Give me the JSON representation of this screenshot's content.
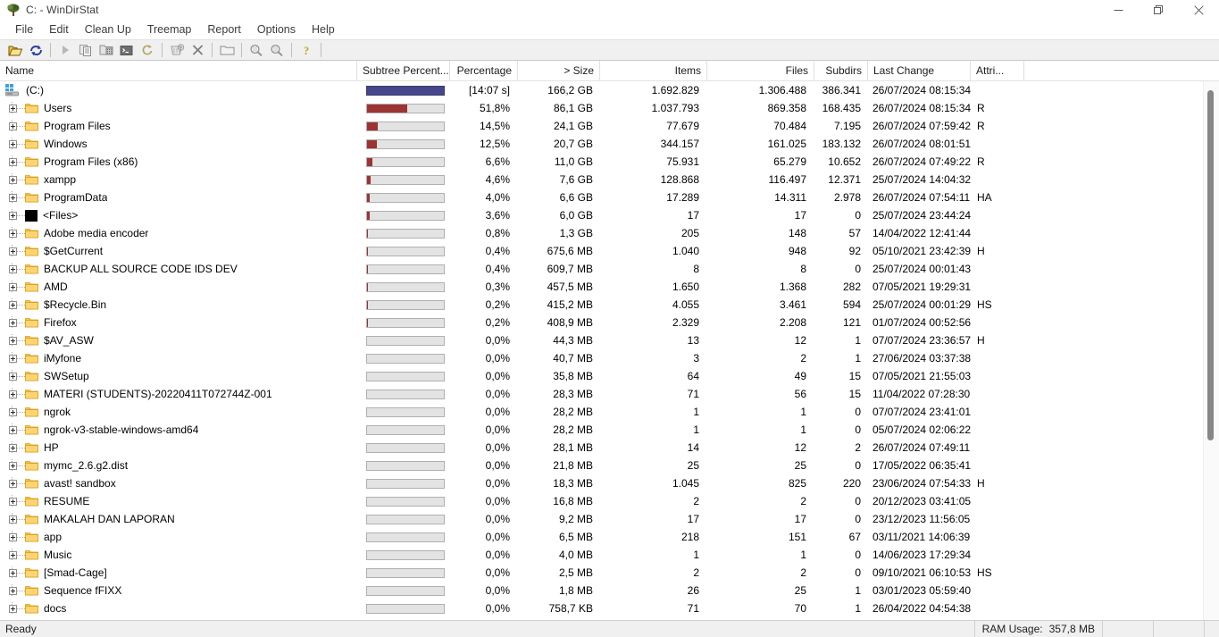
{
  "window": {
    "title": "C: - WinDirStat",
    "app_icon": "tree-icon",
    "minimize_label": "Minimize",
    "maximize_label": "Restore",
    "close_label": "Close"
  },
  "menubar": {
    "items": [
      {
        "label": "File"
      },
      {
        "label": "Edit"
      },
      {
        "label": "Clean Up"
      },
      {
        "label": "Treemap"
      },
      {
        "label": "Report"
      },
      {
        "label": "Options"
      },
      {
        "label": "Help"
      }
    ]
  },
  "toolbar": {
    "buttons": [
      {
        "name": "open-folder-icon",
        "enabled": true
      },
      {
        "name": "rescan-icon",
        "enabled": true
      },
      {
        "name": "separator",
        "enabled": false
      },
      {
        "name": "play-resume-icon",
        "enabled": false
      },
      {
        "name": "copy-path-icon",
        "enabled": false
      },
      {
        "name": "explorer-here-icon",
        "enabled": false
      },
      {
        "name": "command-prompt-icon",
        "enabled": false
      },
      {
        "name": "refresh-selected-icon",
        "enabled": false
      },
      {
        "name": "separator",
        "enabled": false
      },
      {
        "name": "delete-to-recycle-bin-icon",
        "enabled": false
      },
      {
        "name": "delete-icon",
        "enabled": false
      },
      {
        "name": "separator",
        "enabled": false
      },
      {
        "name": "show-treemap-icon",
        "enabled": false
      },
      {
        "name": "separator",
        "enabled": false
      },
      {
        "name": "zoom-in-icon",
        "enabled": false
      },
      {
        "name": "zoom-out-icon",
        "enabled": false
      },
      {
        "name": "separator",
        "enabled": false
      },
      {
        "name": "help-icon",
        "enabled": true
      }
    ]
  },
  "columns": [
    {
      "key": "name",
      "label": "Name",
      "align": "left"
    },
    {
      "key": "bar",
      "label": "Subtree Percent...",
      "align": "left"
    },
    {
      "key": "pct",
      "label": "Percentage",
      "align": "right"
    },
    {
      "key": "size",
      "label": "> Size",
      "align": "right"
    },
    {
      "key": "items",
      "label": "Items",
      "align": "right"
    },
    {
      "key": "files",
      "label": "Files",
      "align": "right"
    },
    {
      "key": "subdirs",
      "label": "Subdirs",
      "align": "right"
    },
    {
      "key": "change",
      "label": "Last Change",
      "align": "left"
    },
    {
      "key": "attr",
      "label": "Attri...",
      "align": "left"
    }
  ],
  "colors": {
    "root_bar": "#45468c",
    "child_bar": "#9c3434",
    "bar_track": "#e3e3e3",
    "folder": "#fbc34a",
    "selection": "#cce8ff"
  },
  "rows": [
    {
      "name": "(C:)",
      "icon": "drive-icon",
      "depth": 0,
      "expandable": false,
      "barpct": 100,
      "barstyle": "root",
      "pct": "[14:07 s]",
      "size": "166,2 GB",
      "items": "1.692.829",
      "files": "1.306.488",
      "subdirs": "386.341",
      "change": "26/07/2024  08:15:34",
      "attr": ""
    },
    {
      "name": "Users",
      "icon": "folder-icon",
      "depth": 1,
      "expandable": true,
      "barpct": 51.8,
      "barstyle": "child",
      "pct": "51,8%",
      "size": "86,1 GB",
      "items": "1.037.793",
      "files": "869.358",
      "subdirs": "168.435",
      "change": "26/07/2024  08:15:34",
      "attr": "R"
    },
    {
      "name": "Program Files",
      "icon": "folder-icon",
      "depth": 1,
      "expandable": true,
      "barpct": 14.5,
      "barstyle": "child",
      "pct": "14,5%",
      "size": "24,1 GB",
      "items": "77.679",
      "files": "70.484",
      "subdirs": "7.195",
      "change": "26/07/2024  07:59:42",
      "attr": "R"
    },
    {
      "name": "Windows",
      "icon": "folder-icon",
      "depth": 1,
      "expandable": true,
      "barpct": 12.5,
      "barstyle": "child",
      "pct": "12,5%",
      "size": "20,7 GB",
      "items": "344.157",
      "files": "161.025",
      "subdirs": "183.132",
      "change": "26/07/2024  08:01:51",
      "attr": ""
    },
    {
      "name": "Program Files (x86)",
      "icon": "folder-icon",
      "depth": 1,
      "expandable": true,
      "barpct": 6.6,
      "barstyle": "child",
      "pct": "6,6%",
      "size": "11,0 GB",
      "items": "75.931",
      "files": "65.279",
      "subdirs": "10.652",
      "change": "26/07/2024  07:49:22",
      "attr": "R"
    },
    {
      "name": "xampp",
      "icon": "folder-icon",
      "depth": 1,
      "expandable": true,
      "barpct": 4.6,
      "barstyle": "child",
      "pct": "4,6%",
      "size": "7,6 GB",
      "items": "128.868",
      "files": "116.497",
      "subdirs": "12.371",
      "change": "25/07/2024  14:04:32",
      "attr": ""
    },
    {
      "name": "ProgramData",
      "icon": "folder-icon",
      "depth": 1,
      "expandable": true,
      "barpct": 4.0,
      "barstyle": "child",
      "pct": "4,0%",
      "size": "6,6 GB",
      "items": "17.289",
      "files": "14.311",
      "subdirs": "2.978",
      "change": "26/07/2024  07:54:11",
      "attr": "HA"
    },
    {
      "name": "<Files>",
      "icon": "files-node-icon",
      "depth": 1,
      "expandable": true,
      "barpct": 3.6,
      "barstyle": "child",
      "pct": "3,6%",
      "size": "6,0 GB",
      "items": "17",
      "files": "17",
      "subdirs": "0",
      "change": "25/07/2024  23:44:24",
      "attr": ""
    },
    {
      "name": "Adobe media encoder",
      "icon": "folder-icon",
      "depth": 1,
      "expandable": true,
      "barpct": 0.8,
      "barstyle": "child",
      "pct": "0,8%",
      "size": "1,3 GB",
      "items": "205",
      "files": "148",
      "subdirs": "57",
      "change": "14/04/2022  12:41:44",
      "attr": ""
    },
    {
      "name": "$GetCurrent",
      "icon": "folder-icon",
      "depth": 1,
      "expandable": true,
      "barpct": 0.4,
      "barstyle": "child",
      "pct": "0,4%",
      "size": "675,6 MB",
      "items": "1.040",
      "files": "948",
      "subdirs": "92",
      "change": "05/10/2021  23:42:39",
      "attr": "H"
    },
    {
      "name": "BACKUP ALL SOURCE CODE IDS DEV",
      "icon": "folder-icon",
      "depth": 1,
      "expandable": true,
      "barpct": 0.4,
      "barstyle": "child",
      "pct": "0,4%",
      "size": "609,7 MB",
      "items": "8",
      "files": "8",
      "subdirs": "0",
      "change": "25/07/2024  00:01:43",
      "attr": ""
    },
    {
      "name": "AMD",
      "icon": "folder-icon",
      "depth": 1,
      "expandable": true,
      "barpct": 0.3,
      "barstyle": "child",
      "pct": "0,3%",
      "size": "457,5 MB",
      "items": "1.650",
      "files": "1.368",
      "subdirs": "282",
      "change": "07/05/2021  19:29:31",
      "attr": ""
    },
    {
      "name": "$Recycle.Bin",
      "icon": "folder-icon",
      "depth": 1,
      "expandable": true,
      "barpct": 0.2,
      "barstyle": "child",
      "pct": "0,2%",
      "size": "415,2 MB",
      "items": "4.055",
      "files": "3.461",
      "subdirs": "594",
      "change": "25/07/2024  00:01:29",
      "attr": "HS"
    },
    {
      "name": "Firefox",
      "icon": "folder-icon",
      "depth": 1,
      "expandable": true,
      "barpct": 0.2,
      "barstyle": "child",
      "pct": "0,2%",
      "size": "408,9 MB",
      "items": "2.329",
      "files": "2.208",
      "subdirs": "121",
      "change": "01/07/2024  00:52:56",
      "attr": ""
    },
    {
      "name": "$AV_ASW",
      "icon": "folder-icon",
      "depth": 1,
      "expandable": true,
      "barpct": 0,
      "barstyle": "child",
      "pct": "0,0%",
      "size": "44,3 MB",
      "items": "13",
      "files": "12",
      "subdirs": "1",
      "change": "07/07/2024  23:36:57",
      "attr": "H"
    },
    {
      "name": "iMyfone",
      "icon": "folder-icon",
      "depth": 1,
      "expandable": true,
      "barpct": 0,
      "barstyle": "child",
      "pct": "0,0%",
      "size": "40,7 MB",
      "items": "3",
      "files": "2",
      "subdirs": "1",
      "change": "27/06/2024  03:37:38",
      "attr": ""
    },
    {
      "name": "SWSetup",
      "icon": "folder-icon",
      "depth": 1,
      "expandable": true,
      "barpct": 0,
      "barstyle": "child",
      "pct": "0,0%",
      "size": "35,8 MB",
      "items": "64",
      "files": "49",
      "subdirs": "15",
      "change": "07/05/2021  21:55:03",
      "attr": ""
    },
    {
      "name": "MATERI (STUDENTS)-20220411T072744Z-001",
      "icon": "folder-icon",
      "depth": 1,
      "expandable": true,
      "barpct": 0,
      "barstyle": "child",
      "pct": "0,0%",
      "size": "28,3 MB",
      "items": "71",
      "files": "56",
      "subdirs": "15",
      "change": "11/04/2022  07:28:30",
      "attr": ""
    },
    {
      "name": "ngrok",
      "icon": "folder-icon",
      "depth": 1,
      "expandable": true,
      "barpct": 0,
      "barstyle": "child",
      "pct": "0,0%",
      "size": "28,2 MB",
      "items": "1",
      "files": "1",
      "subdirs": "0",
      "change": "07/07/2024  23:41:01",
      "attr": ""
    },
    {
      "name": "ngrok-v3-stable-windows-amd64",
      "icon": "folder-icon",
      "depth": 1,
      "expandable": true,
      "barpct": 0,
      "barstyle": "child",
      "pct": "0,0%",
      "size": "28,2 MB",
      "items": "1",
      "files": "1",
      "subdirs": "0",
      "change": "05/07/2024  02:06:22",
      "attr": ""
    },
    {
      "name": "HP",
      "icon": "folder-icon",
      "depth": 1,
      "expandable": true,
      "barpct": 0,
      "barstyle": "child",
      "pct": "0,0%",
      "size": "28,1 MB",
      "items": "14",
      "files": "12",
      "subdirs": "2",
      "change": "26/07/2024  07:49:11",
      "attr": ""
    },
    {
      "name": "mymc_2.6.g2.dist",
      "icon": "folder-icon",
      "depth": 1,
      "expandable": true,
      "barpct": 0,
      "barstyle": "child",
      "pct": "0,0%",
      "size": "21,8 MB",
      "items": "25",
      "files": "25",
      "subdirs": "0",
      "change": "17/05/2022  06:35:41",
      "attr": ""
    },
    {
      "name": "avast! sandbox",
      "icon": "folder-icon",
      "depth": 1,
      "expandable": true,
      "barpct": 0,
      "barstyle": "child",
      "pct": "0,0%",
      "size": "18,3 MB",
      "items": "1.045",
      "files": "825",
      "subdirs": "220",
      "change": "23/06/2024  07:54:33",
      "attr": "H"
    },
    {
      "name": "RESUME",
      "icon": "folder-icon",
      "depth": 1,
      "expandable": true,
      "barpct": 0,
      "barstyle": "child",
      "pct": "0,0%",
      "size": "16,8 MB",
      "items": "2",
      "files": "2",
      "subdirs": "0",
      "change": "20/12/2023  03:41:05",
      "attr": ""
    },
    {
      "name": "MAKALAH DAN LAPORAN",
      "icon": "folder-icon",
      "depth": 1,
      "expandable": true,
      "barpct": 0,
      "barstyle": "child",
      "pct": "0,0%",
      "size": "9,2 MB",
      "items": "17",
      "files": "17",
      "subdirs": "0",
      "change": "23/12/2023  11:56:05",
      "attr": ""
    },
    {
      "name": "app",
      "icon": "folder-icon",
      "depth": 1,
      "expandable": true,
      "barpct": 0,
      "barstyle": "child",
      "pct": "0,0%",
      "size": "6,5 MB",
      "items": "218",
      "files": "151",
      "subdirs": "67",
      "change": "03/11/2021  14:06:39",
      "attr": ""
    },
    {
      "name": "Music",
      "icon": "folder-icon",
      "depth": 1,
      "expandable": true,
      "barpct": 0,
      "barstyle": "child",
      "pct": "0,0%",
      "size": "4,0 MB",
      "items": "1",
      "files": "1",
      "subdirs": "0",
      "change": "14/06/2023  17:29:34",
      "attr": ""
    },
    {
      "name": "[Smad-Cage]",
      "icon": "folder-icon",
      "depth": 1,
      "expandable": true,
      "barpct": 0,
      "barstyle": "child",
      "pct": "0,0%",
      "size": "2,5 MB",
      "items": "2",
      "files": "2",
      "subdirs": "0",
      "change": "09/10/2021  06:10:53",
      "attr": "HS"
    },
    {
      "name": "Sequence fFIXX",
      "icon": "folder-icon",
      "depth": 1,
      "expandable": true,
      "barpct": 0,
      "barstyle": "child",
      "pct": "0,0%",
      "size": "1,8 MB",
      "items": "26",
      "files": "25",
      "subdirs": "1",
      "change": "03/01/2023  05:59:40",
      "attr": ""
    },
    {
      "name": "docs",
      "icon": "folder-icon",
      "depth": 1,
      "expandable": true,
      "barpct": 0,
      "barstyle": "child",
      "pct": "0,0%",
      "size": "758,7 KB",
      "items": "71",
      "files": "70",
      "subdirs": "1",
      "change": "26/04/2022  04:54:38",
      "attr": ""
    }
  ],
  "scrollbar": {
    "thumb_top_pct": 1.6,
    "thumb_height_pct": 65
  },
  "statusbar": {
    "message": "Ready",
    "ram_label": "RAM Usage:",
    "ram_value": "357,8 MB"
  }
}
